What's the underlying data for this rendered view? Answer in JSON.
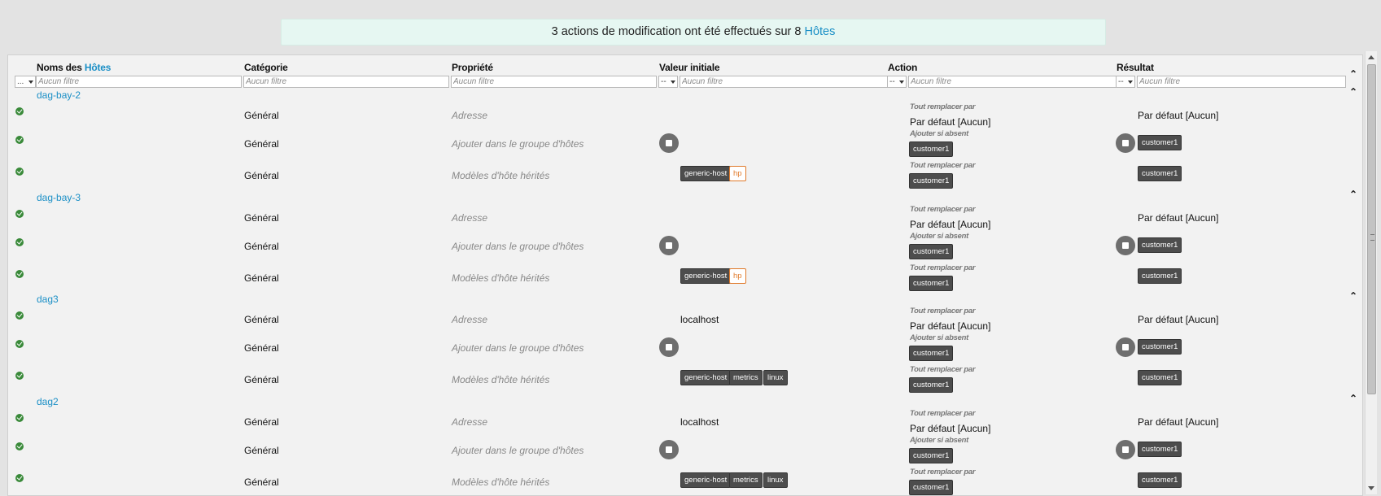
{
  "banner": {
    "text": "3 actions de modification ont été effectués sur 8",
    "link": "Hôtes"
  },
  "table": {
    "headers": {
      "names_prefix": "Noms des",
      "names_link": "Hôtes",
      "category": "Catégorie",
      "property": "Propriété",
      "initial_value": "Valeur initiale",
      "action": "Action",
      "result": "Résultat"
    },
    "filter_placeholder": "Aucun filtre",
    "select_all": "...",
    "dropdown": "--"
  },
  "labels": {
    "category": "Général",
    "prop_address": "Adresse",
    "prop_group": "Ajouter dans le groupe d'hôtes",
    "prop_models": "Modèles d'hôte hérités",
    "replace_all": "Tout remplacer par",
    "add_if_absent": "Ajouter si absent",
    "default_none": "Par défaut [Aucun]",
    "customer1": "customer1",
    "generic_host": "generic-host",
    "hp": "hp",
    "metrics": "metrics",
    "linux": "linux",
    "localhost": "localhost"
  },
  "hosts": [
    "dag-bay-2",
    "dag-bay-3",
    "dag3",
    "dag2"
  ],
  "colors": {
    "link": "#1a8fc6",
    "success": "#3a8a3a",
    "tag_dark": "#4d4d4d",
    "tag_orange": "#e07a2b"
  },
  "icons": [
    "check-icon",
    "stop-icon",
    "collapse-icon",
    "caret-down-icon"
  ]
}
